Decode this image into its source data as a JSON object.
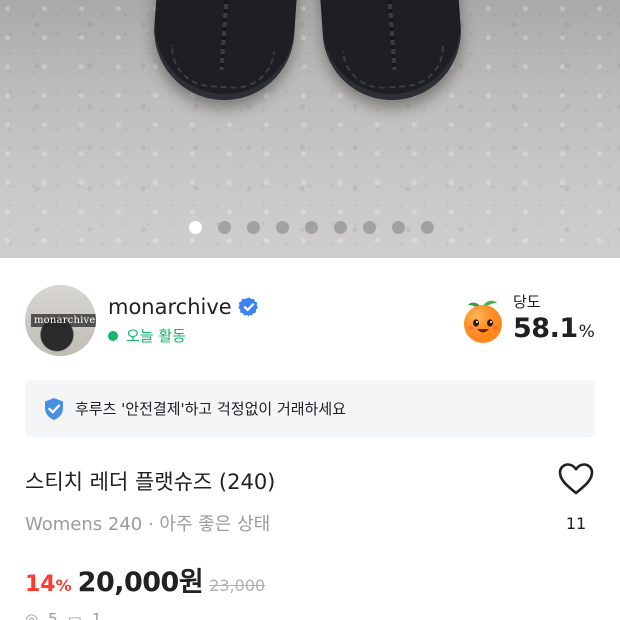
{
  "photo": {
    "alt_icon": "product-photo",
    "pager": {
      "count": 9,
      "active_index": 0
    }
  },
  "seller": {
    "name": "monarchive",
    "avatar_text": "monarchive",
    "verified_icon": "verified-check-icon",
    "activity": "오늘 활동",
    "activity_color": "#12b76a"
  },
  "sweetness": {
    "label": "당도",
    "value": "58.1",
    "unit": "%",
    "icon": "peach-icon"
  },
  "banner": {
    "icon": "shield-check-icon",
    "text": "후루츠 '안전결제'하고 걱정없이 거래하세요"
  },
  "product": {
    "title": "스티치 레더 플랫슈즈 (240)",
    "meta": "Womens 240 · 아주 좋은 상태",
    "like_count": "11",
    "like_icon": "heart-outline-icon",
    "discount_value": "14",
    "discount_unit": "%",
    "price": "20,000원",
    "original_price": "23,000",
    "discount_color": "#ff3b30"
  },
  "stats": {
    "views": "5",
    "chats": "1"
  }
}
